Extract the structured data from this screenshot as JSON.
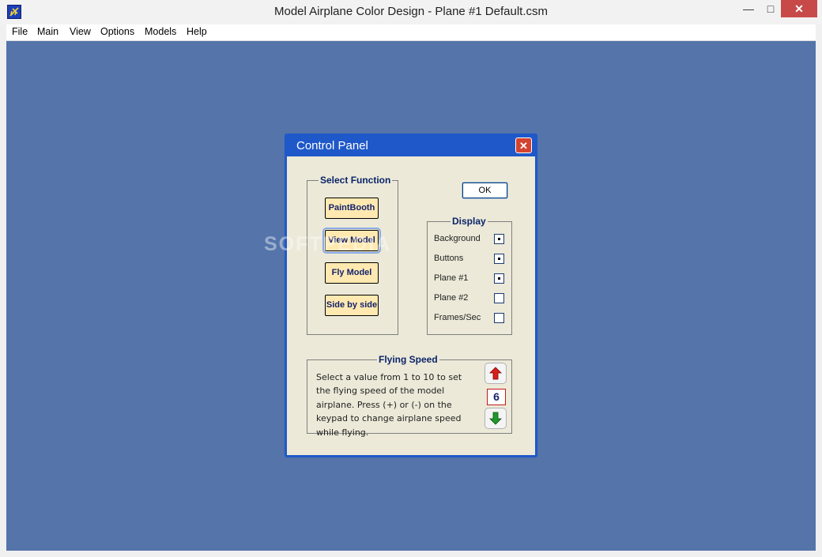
{
  "window": {
    "title": "Model Airplane Color Design - Plane #1  Default.csm",
    "minimize_glyph": "—",
    "maximize_glyph": "□",
    "close_glyph": "✕"
  },
  "menu": {
    "items": [
      {
        "label": "File"
      },
      {
        "label": "Main"
      },
      {
        "label": "View"
      },
      {
        "label": "Options"
      },
      {
        "label": "Models"
      },
      {
        "label": "Help"
      }
    ]
  },
  "dialog": {
    "title": "Control Panel",
    "close_glyph": "✕",
    "ok_label": "OK",
    "select_function": {
      "title": "Select Function",
      "buttons": [
        {
          "label": "PaintBooth",
          "focused": false
        },
        {
          "label": "View Model",
          "focused": true
        },
        {
          "label": "Fly Model",
          "focused": false
        },
        {
          "label": "Side by side",
          "focused": false
        }
      ]
    },
    "display": {
      "title": "Display",
      "items": [
        {
          "label": "Background",
          "checked": true
        },
        {
          "label": "Buttons",
          "checked": true
        },
        {
          "label": "Plane #1",
          "checked": true
        },
        {
          "label": "Plane #2",
          "checked": false
        },
        {
          "label": "Frames/Sec",
          "checked": false
        }
      ]
    },
    "flying_speed": {
      "title": "Flying Speed",
      "description": "Select a value from 1 to 10 to set the flying speed of the model airplane. Press (+) or (-) on the keypad to change airplane speed while flying.",
      "value": "6",
      "up_icon": "red-up-arrow-icon",
      "down_icon": "green-down-arrow-icon"
    }
  },
  "watermark": "SOFTPEDIA",
  "colors": {
    "desktop": "#5474aa",
    "dialog_frame": "#1f58c9",
    "dialog_body": "#ece9d8",
    "function_button": "#ffe9b0",
    "up_arrow": "#d9201a",
    "down_arrow": "#1f9a2a"
  }
}
